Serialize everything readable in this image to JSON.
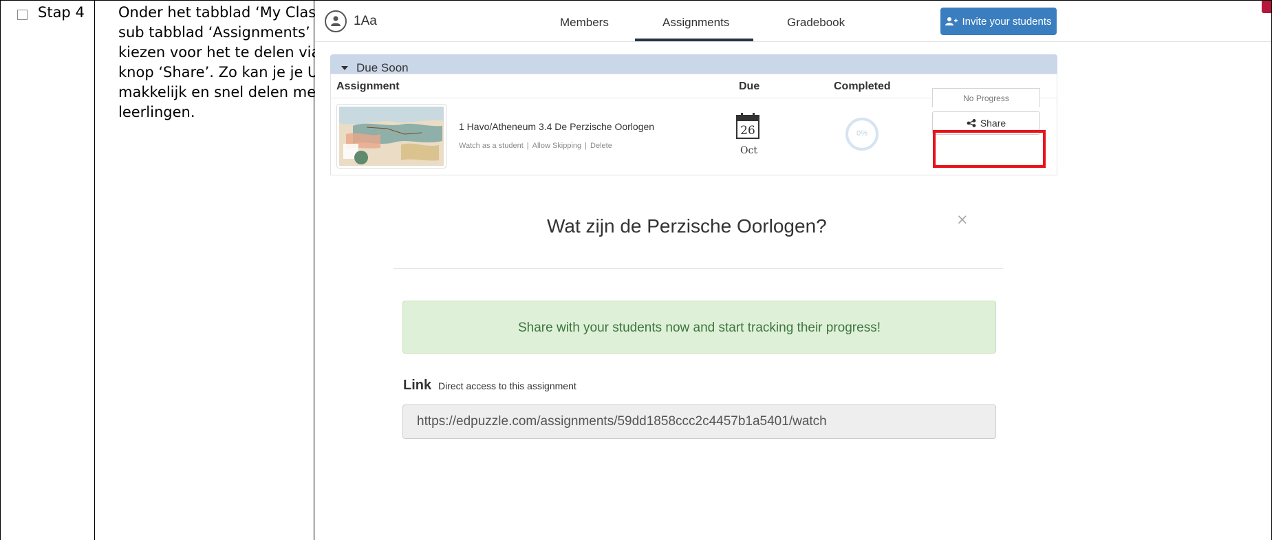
{
  "doc": {
    "step_label": "Stap 4",
    "description": "Onder het tabblad ‘My Classes’ en sub tabblad ‘Assignments’ kan je kiezen voor het te delen via de knop ‘Share’. Zo kan je je URL makkelijk en snel delen met de leerlingen."
  },
  "app": {
    "class_name": "1Aa",
    "tabs": [
      "Members",
      "Assignments",
      "Gradebook"
    ],
    "active_tab": "Assignments",
    "invite_label": "Invite your students",
    "accent_color": "#3a7ec0",
    "section_label": "Due Soon",
    "columns": [
      "Assignment",
      "Due",
      "Completed"
    ],
    "assignment": {
      "title": "1 Havo/Atheneum 3.4 De Perzische Oorlogen",
      "links": [
        "Watch as a student",
        "Allow Skipping",
        "Delete"
      ],
      "due_day": "26",
      "due_month": "Oct",
      "completed": "0%",
      "progress_status": "No Progress",
      "share_label": "Share"
    }
  },
  "modal": {
    "title": "Wat zijn de Perzische Oorlogen?",
    "close_glyph": "×",
    "alert": "Share with your students now and start tracking their progress!",
    "link_label": "Link",
    "link_sub": "Direct access to this assignment",
    "url": "https://edpuzzle.com/assignments/59dd1858ccc2c4457b1a5401/watch"
  }
}
